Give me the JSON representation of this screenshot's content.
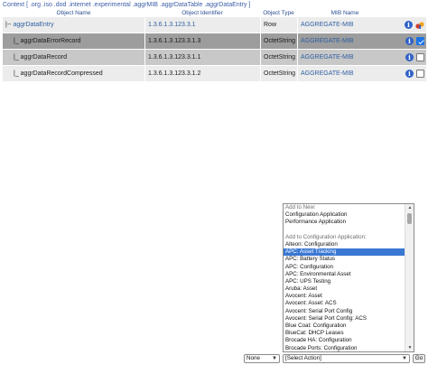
{
  "context": "Context [ .org .iso .dod .internet .experimental .aggrMIB .aggrDataTable .aggrDataEntry ]",
  "table": {
    "headers": [
      "Object Name",
      "Object Identifier",
      "Object Type",
      "MIB Name"
    ],
    "rows": [
      {
        "prefix": "|-- ",
        "name": "aggrDataEntry",
        "oid": "1.3.6.1.3.123.3.1",
        "type": "Row",
        "mib": "AGGREGATE-MIB",
        "name_link": true,
        "oid_link": true,
        "info_icon": "info-icon",
        "extra_icon": "tools-icon",
        "checkbox": null
      },
      {
        "prefix": "|_ ",
        "name": "aggrDataErrorRecord",
        "oid": "1.3.6.1.3.123.3.1.3",
        "type": "OctetString",
        "mib": "AGGREGATE-MIB",
        "name_link": false,
        "oid_link": false,
        "info_icon": "info-icon",
        "extra_icon": null,
        "checkbox": true
      },
      {
        "prefix": "|_ ",
        "name": "aggrDataRecord",
        "oid": "1.3.6.1.3.123.3.1.1",
        "type": "OctetString",
        "mib": "AGGREGATE-MIB",
        "name_link": false,
        "oid_link": false,
        "info_icon": "info-icon",
        "extra_icon": null,
        "checkbox": false
      },
      {
        "prefix": "|_ ",
        "name": "aggrDataRecordCompressed",
        "oid": "1.3.6.1.3.123.3.1.2",
        "type": "OctetString",
        "mib": "AGGREGATE-MIB",
        "name_link": false,
        "oid_link": false,
        "info_icon": "info-icon",
        "extra_icon": null,
        "checkbox": false
      }
    ]
  },
  "action_list": {
    "options": [
      {
        "label": "Add to New:",
        "kind": "group"
      },
      {
        "label": "Configuration Application",
        "kind": "item"
      },
      {
        "label": "Performance Application",
        "kind": "item"
      },
      {
        "label": "",
        "kind": "blank"
      },
      {
        "label": "Add to Configuration Application:",
        "kind": "group"
      },
      {
        "label": "Alteon: Configuration",
        "kind": "item"
      },
      {
        "label": "APC: Asset Tracking",
        "kind": "selected"
      },
      {
        "label": "APC: Battery Status",
        "kind": "item"
      },
      {
        "label": "APC: Configuration",
        "kind": "item"
      },
      {
        "label": "APC: Environmental Asset",
        "kind": "item"
      },
      {
        "label": "APC: UPS Testing",
        "kind": "item"
      },
      {
        "label": "Aruba: Asset",
        "kind": "item"
      },
      {
        "label": "Avocent: Asset",
        "kind": "item"
      },
      {
        "label": "Avocent: Asset: ACS",
        "kind": "item"
      },
      {
        "label": "Avocent: Serial Port Config",
        "kind": "item"
      },
      {
        "label": "Avocent: Serial Port Config: ACS",
        "kind": "item"
      },
      {
        "label": "Blue Coat: Configuration",
        "kind": "item"
      },
      {
        "label": "BlueCat: DHCP Leases",
        "kind": "item"
      },
      {
        "label": "Brocade HA: Configuration",
        "kind": "item"
      },
      {
        "label": "Brocade Ports: Configuration",
        "kind": "item"
      }
    ]
  },
  "bottom": {
    "none_select": "None",
    "action_select": "[Select Action]",
    "go_label": "Go"
  },
  "colors": {
    "link": "#2e5fa3",
    "selected_option": "#3a78d4",
    "checked": "#1a73e8"
  }
}
